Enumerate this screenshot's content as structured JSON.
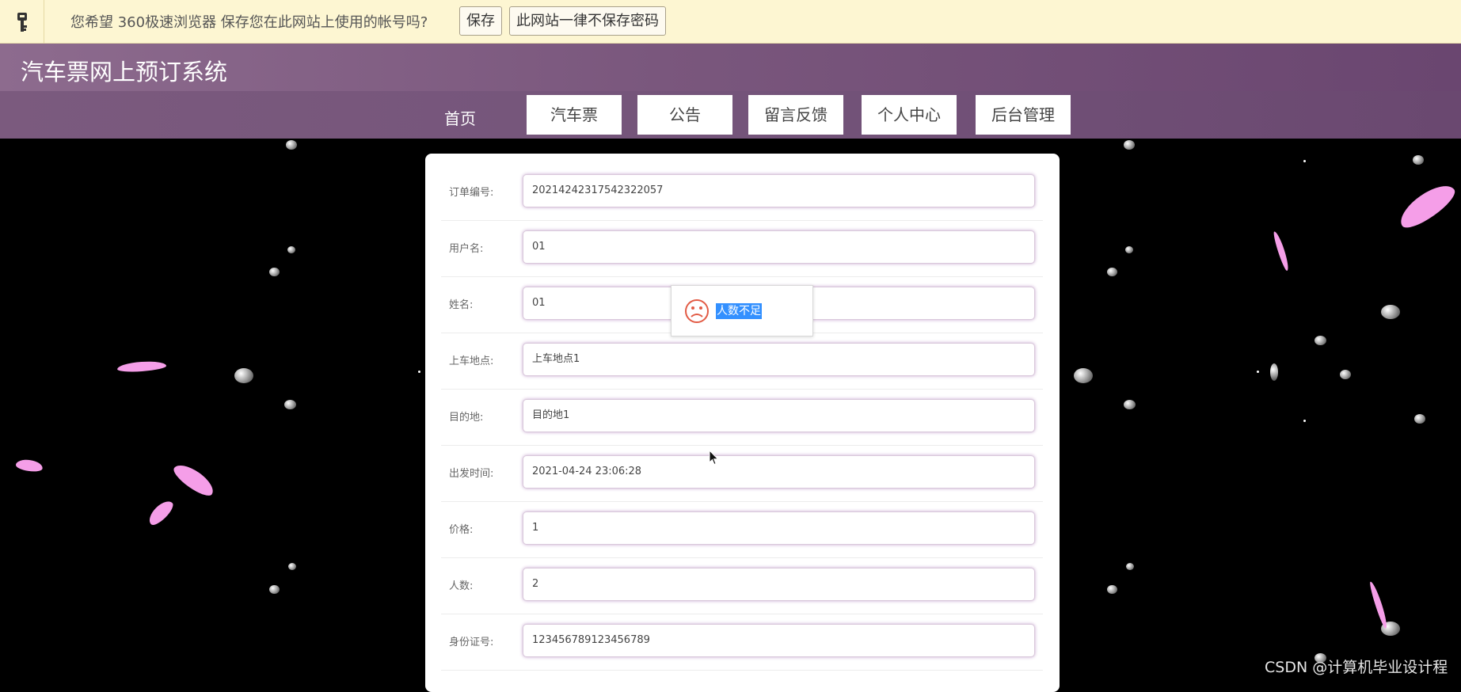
{
  "browser_prompt": {
    "message": "您希望 360极速浏览器 保存您在此网站上使用的帐号吗?",
    "save_label": "保存",
    "never_label": "此网站一律不保存密码"
  },
  "site": {
    "title": "汽车票网上预订系统"
  },
  "nav": {
    "home": "首页",
    "items": [
      "汽车票",
      "公告",
      "留言反馈",
      "个人中心",
      "后台管理"
    ]
  },
  "form": {
    "fields": [
      {
        "label": "订单编号:",
        "value": "20214242317542322057"
      },
      {
        "label": "用户名:",
        "value": "01"
      },
      {
        "label": "姓名:",
        "value": "01"
      },
      {
        "label": "上车地点:",
        "value": "上车地点1"
      },
      {
        "label": "目的地:",
        "value": "目的地1"
      },
      {
        "label": "出发时间:",
        "value": "2021-04-24 23:06:28"
      },
      {
        "label": "价格:",
        "value": "1"
      },
      {
        "label": "人数:",
        "value": "2"
      },
      {
        "label": "身份证号:",
        "value": "123456789123456789"
      }
    ]
  },
  "toast": {
    "icon": "sad-face-icon",
    "message": "人数不足"
  },
  "watermark": "CSDN @计算机毕业设计程",
  "colors": {
    "header": "#7a577d",
    "prompt_bg": "#fdf6d2",
    "petal": "#f59ee8",
    "toast_icon": "#e25b45",
    "selection": "#3390ff"
  }
}
